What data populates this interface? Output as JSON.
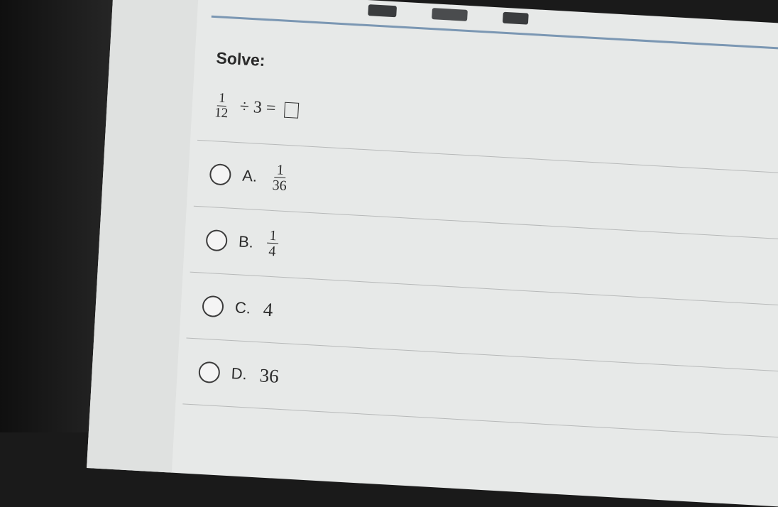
{
  "question": {
    "prompt": "Solve:",
    "numerator": "1",
    "denominator": "12",
    "operator": "÷",
    "divisor": "3",
    "equals": "="
  },
  "options": [
    {
      "letter": "A.",
      "numerator": "1",
      "denominator": "36"
    },
    {
      "letter": "B.",
      "numerator": "1",
      "denominator": "4"
    },
    {
      "letter": "C.",
      "value": "4"
    },
    {
      "letter": "D.",
      "value": "36"
    }
  ]
}
